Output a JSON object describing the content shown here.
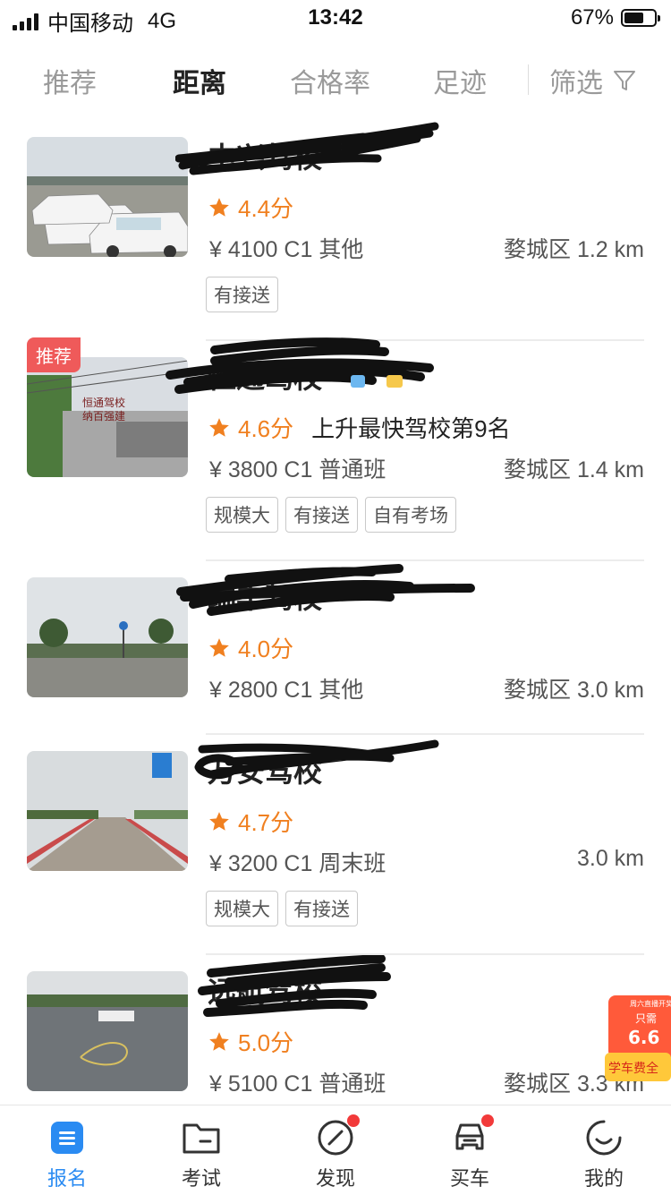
{
  "status_bar": {
    "carrier": "中国移动",
    "network": "4G",
    "time": "13:42",
    "battery": "67%",
    "battery_level": 0.67
  },
  "tabs": [
    {
      "label": "推荐",
      "active": false
    },
    {
      "label": "距离",
      "active": true
    },
    {
      "label": "合格率",
      "active": false
    },
    {
      "label": "足迹",
      "active": false
    }
  ],
  "filter": {
    "label": "筛选",
    "icon": "filter-icon"
  },
  "schools": [
    {
      "name": "中兴驾校",
      "score": "4.4分",
      "price": "¥ 4100 C1 其他",
      "location": "婺城区 1.2 km",
      "tags": [
        "有接送"
      ],
      "badge": "",
      "rank_text": ""
    },
    {
      "name": "恒通驾校",
      "score": "4.6分",
      "price": "¥ 3800 C1 普通班",
      "location": "婺城区 1.4 km",
      "tags": [
        "规模大",
        "有接送",
        "自有考场"
      ],
      "badge": "推荐",
      "rank_text": "上升最快驾校第9名"
    },
    {
      "name": "瑞丰驾校",
      "score": "4.0分",
      "price": "¥ 2800 C1 其他",
      "location": "婺城区 3.0 km",
      "tags": [],
      "badge": "",
      "rank_text": ""
    },
    {
      "name": "万安驾校",
      "score": "4.7分",
      "price": "¥ 3200 C1 周末班",
      "location": "3.0 km",
      "tags": [
        "规模大",
        "有接送"
      ],
      "badge": "",
      "rank_text": ""
    },
    {
      "name": "远航驾校",
      "score": "5.0分",
      "price": "¥ 5100 C1 普通班",
      "location": "婺城区 3.3 km",
      "tags": [],
      "badge": "",
      "rank_text": ""
    }
  ],
  "promo": {
    "line1": "周六直播开奖",
    "line2": "只需",
    "amount": "6.6",
    "line3": "学车费全"
  },
  "bottom_nav": [
    {
      "label": "报名",
      "icon": "signup-icon",
      "active": true,
      "dot": false
    },
    {
      "label": "考试",
      "icon": "exam-folder-icon",
      "active": false,
      "dot": false
    },
    {
      "label": "发现",
      "icon": "compass-icon",
      "active": false,
      "dot": true
    },
    {
      "label": "买车",
      "icon": "car-icon",
      "active": false,
      "dot": true
    },
    {
      "label": "我的",
      "icon": "profile-smile-icon",
      "active": false,
      "dot": false
    }
  ],
  "colors": {
    "accent": "#2a8bf2",
    "star": "#f08020",
    "badge": "#ef5a5a",
    "dot": "#f23a3a"
  }
}
